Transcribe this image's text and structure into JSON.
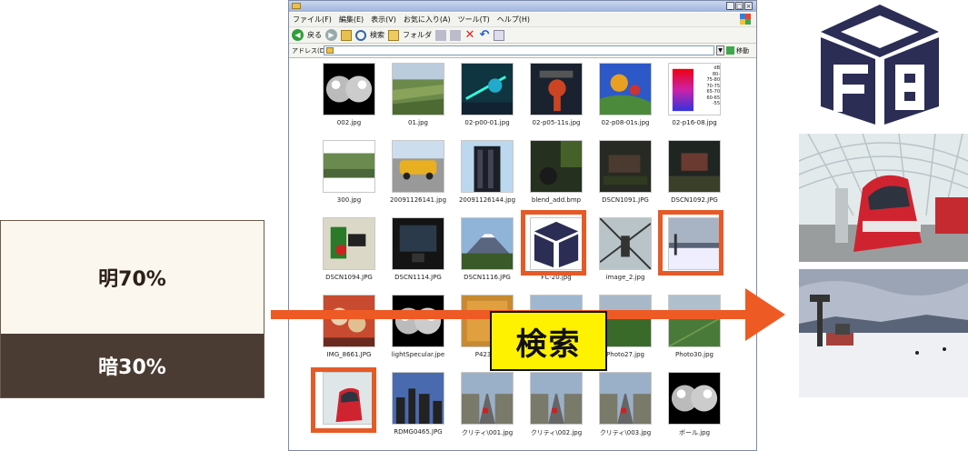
{
  "query": {
    "bright_label": "明70%",
    "dark_label": "暗30%",
    "colors": {
      "bright": "#fbf6ee",
      "dark": "#4a3c33"
    }
  },
  "search_label": "検索",
  "explorer": {
    "menu": [
      "ファイル(F)",
      "編集(E)",
      "表示(V)",
      "お気に入り(A)",
      "ツール(T)",
      "ヘルプ(H)"
    ],
    "toolbar": {
      "back": "戻る",
      "search": "検索",
      "folders": "フォルダ"
    },
    "address_label": "アドレス(D)",
    "go_label": "移動",
    "files": [
      {
        "name": "002.jpg",
        "thumb": "sphere"
      },
      {
        "name": "01.jpg",
        "thumb": "field"
      },
      {
        "name": "02-p00-01.jpg",
        "thumb": "circuit"
      },
      {
        "name": "02-p05-11s.jpg",
        "thumb": "robot"
      },
      {
        "name": "02-p08-01s.jpg",
        "thumb": "balloon"
      },
      {
        "name": "02-p16-08.jpg",
        "thumb": "heatmap"
      },
      {
        "name": "300.jpg",
        "thumb": "train"
      },
      {
        "name": "20091126141.jpg",
        "thumb": "taxi"
      },
      {
        "name": "20091126144.jpg",
        "thumb": "tower"
      },
      {
        "name": "blend_add.bmp",
        "thumb": "dark"
      },
      {
        "name": "DSCN1091.JPG",
        "thumb": "room"
      },
      {
        "name": "DSCN1092.JPG",
        "thumb": "room2"
      },
      {
        "name": "DSCN1094.JPG",
        "thumb": "booth"
      },
      {
        "name": "DSCN1114.JPG",
        "thumb": "screen"
      },
      {
        "name": "DSCN1116.JPG",
        "thumb": "fuji"
      },
      {
        "name": "FC-20.jpg",
        "thumb": "logo"
      },
      {
        "name": "image_2.jpg",
        "thumb": "mast"
      },
      {
        "name": "",
        "thumb": "snow"
      },
      {
        "name": "IMG_8661.JPG",
        "thumb": "food"
      },
      {
        "name": "lightSpecular.jpe",
        "thumb": "sphere"
      },
      {
        "name": "P42300",
        "thumb": "poster"
      },
      {
        "name": "",
        "thumb": "landscape"
      },
      {
        "name": "Photo27.jpg",
        "thumb": "green"
      },
      {
        "name": "Photo30.jpg",
        "thumb": "field2"
      },
      {
        "name": "",
        "thumb": "station"
      },
      {
        "name": "RDMG0465.JPG",
        "thumb": "city"
      },
      {
        "name": "クリティ\\001.jpg",
        "thumb": "street"
      },
      {
        "name": "クリティ\\002.jpg",
        "thumb": "street"
      },
      {
        "name": "クリティ\\003.jpg",
        "thumb": "street"
      },
      {
        "name": "ボール.jpg",
        "thumb": "sphere"
      }
    ]
  },
  "heatmap_legend": [
    "dB",
    "80-",
    "75-80",
    "70-75",
    "65-70",
    "60-65",
    "-55"
  ],
  "colors": {
    "arrow": "#ee5a24",
    "highlight": "#e65a28",
    "search_bg": "#fff200",
    "logo": "#2b2d55"
  }
}
